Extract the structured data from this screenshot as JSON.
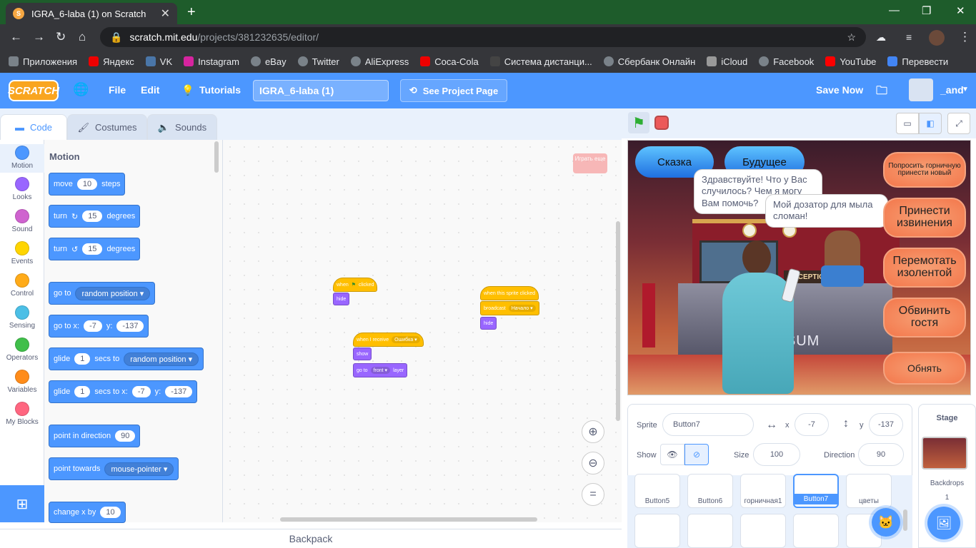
{
  "browser": {
    "tab_title": "IGRA_6-laba (1) on Scratch",
    "url_host": "scratch.mit.edu",
    "url_path": "/projects/381232635/editor/",
    "bookmarks": [
      "Приложения",
      "Яндекс",
      "VK",
      "Instagram",
      "eBay",
      "Twitter",
      "AliExpress",
      "Coca-Cola",
      "Система дистанци...",
      "Сбербанк Онлайн",
      "iCloud",
      "Facebook",
      "YouTube",
      "Перевести"
    ]
  },
  "menubar": {
    "logo": "SCRATCH",
    "file": "File",
    "edit": "Edit",
    "tutorials": "Tutorials",
    "project_title": "IGRA_6-laba (1)",
    "see_project": "See Project Page",
    "save_now": "Save Now",
    "username": "_and"
  },
  "editor_tabs": {
    "code": "Code",
    "costumes": "Costumes",
    "sounds": "Sounds"
  },
  "categories": [
    {
      "label": "Motion",
      "color": "#4c97ff"
    },
    {
      "label": "Looks",
      "color": "#9966ff"
    },
    {
      "label": "Sound",
      "color": "#cf63cf"
    },
    {
      "label": "Events",
      "color": "#ffd500"
    },
    {
      "label": "Control",
      "color": "#ffab19"
    },
    {
      "label": "Sensing",
      "color": "#4cbfe6"
    },
    {
      "label": "Operators",
      "color": "#40bf4a"
    },
    {
      "label": "Variables",
      "color": "#ff8c1a"
    },
    {
      "label": "My Blocks",
      "color": "#ff6680"
    }
  ],
  "palette": {
    "title": "Motion",
    "move": {
      "a": "move",
      "v": "10",
      "b": "steps"
    },
    "turn_right": {
      "a": "turn",
      "v": "15",
      "b": "degrees"
    },
    "turn_left": {
      "a": "turn",
      "v": "15",
      "b": "degrees"
    },
    "goto": {
      "a": "go to",
      "v": "random position"
    },
    "gotoxy": {
      "a": "go to x:",
      "x": "-7",
      "b": "y:",
      "y": "-137"
    },
    "glide_to": {
      "a": "glide",
      "v": "1",
      "b": "secs to",
      "c": "random position"
    },
    "glide_xy": {
      "a": "glide",
      "v": "1",
      "b": "secs to x:",
      "x": "-7",
      "c": "y:",
      "y": "-137"
    },
    "point_dir": {
      "a": "point in direction",
      "v": "90"
    },
    "point_towards": {
      "a": "point towards",
      "v": "mouse-pointer"
    },
    "change_x": {
      "a": "change x by",
      "v": "10"
    }
  },
  "workspace": {
    "ghost_button": "Играть еще",
    "script1": {
      "hat_a": "when",
      "hat_b": "clicked",
      "b1": "hide"
    },
    "script2": {
      "hat_a": "when I receive",
      "hat_v": "Ошибка",
      "b1": "show",
      "b2_a": "go to",
      "b2_v": "front",
      "b2_b": "layer"
    },
    "script3": {
      "hat": "when this sprite clicked",
      "b1_a": "broadcast",
      "b1_v": "Начало",
      "b2": "hide"
    }
  },
  "backpack": "Backpack",
  "stage": {
    "btn_skazka": "Сказка",
    "btn_budushee": "Будущее",
    "bubble_receptionist": "Здравствуйте! Что у Вас случилось? Чем я могу Вам помочь?",
    "bubble_guest": "Мой дозатор для мыла сломан!",
    "sign": "RECEPTION",
    "desk_text": "IPSUM",
    "right_buttons": [
      "Попросить горничную принести новый",
      "Принести извинения",
      "Перемотать изолентой",
      "Обвинить гостя",
      "Обнять"
    ]
  },
  "sprite_info": {
    "sprite_label": "Sprite",
    "sprite_name": "Button7",
    "x_label": "x",
    "x": "-7",
    "y_label": "y",
    "y": "-137",
    "show_label": "Show",
    "size_label": "Size",
    "size": "100",
    "direction_label": "Direction",
    "direction": "90"
  },
  "sprites": [
    "Button5",
    "Button6",
    "горничная1",
    "Button7",
    "цветы"
  ],
  "stage_panel": {
    "title": "Stage",
    "backdrops_label": "Backdrops",
    "backdrops_count": "1"
  }
}
